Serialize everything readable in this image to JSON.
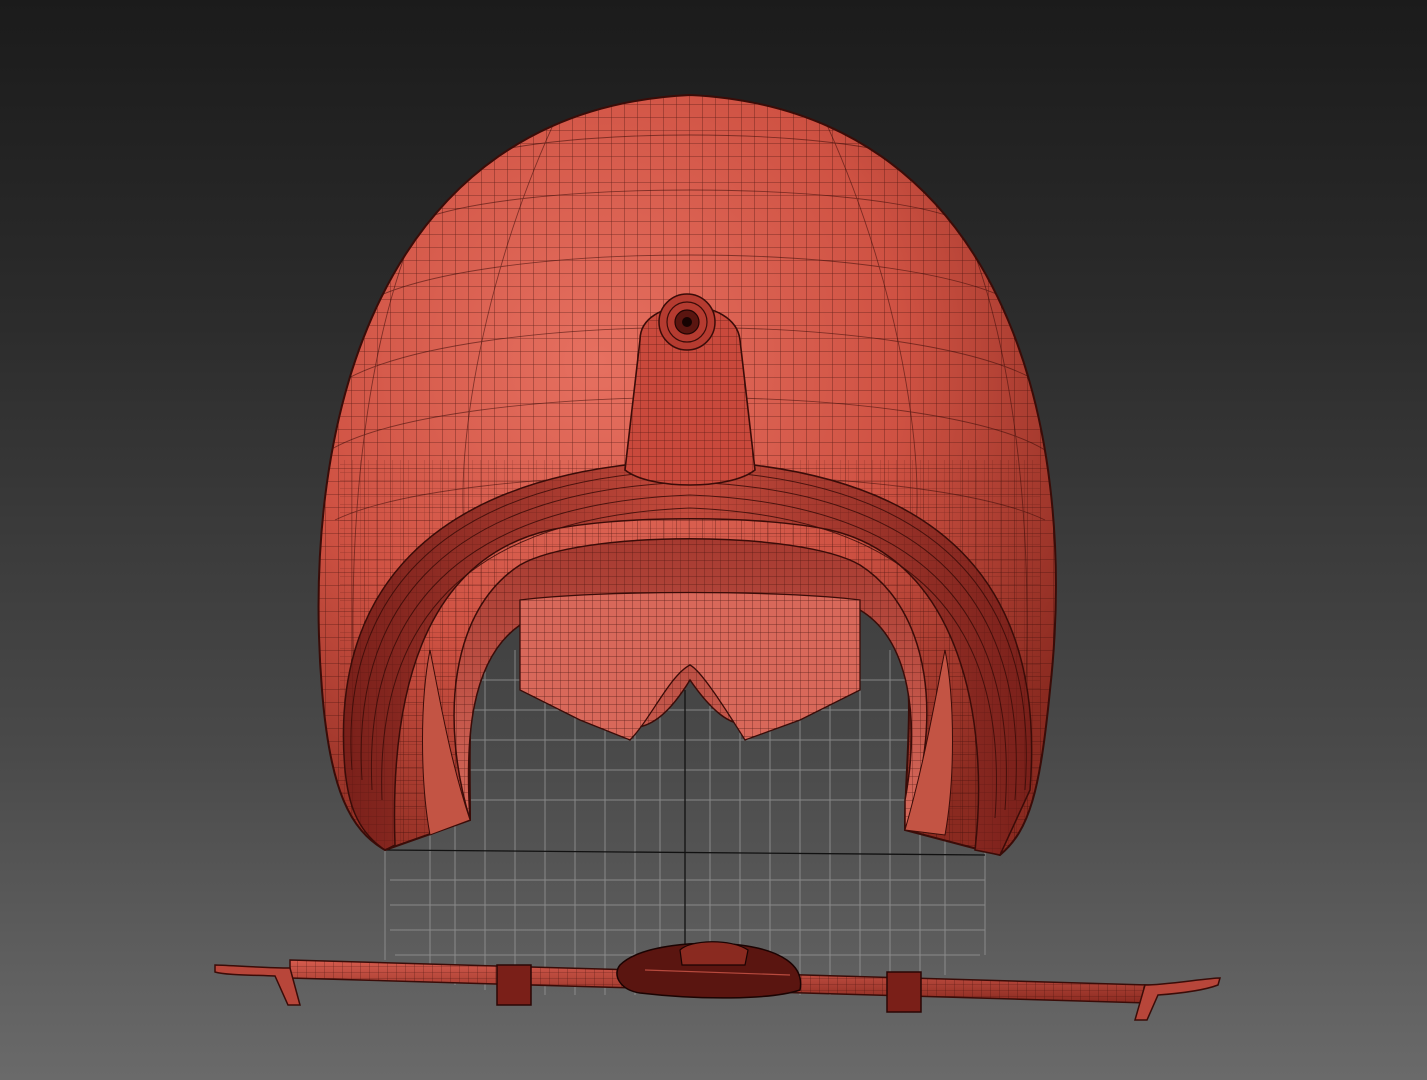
{
  "scene": {
    "subject": "helmet-wireframe-model",
    "colors": {
      "background_top": "#1b1b1b",
      "background_bottom": "#6a6a6a",
      "mesh_fill_light": "#e0685a",
      "mesh_fill_mid": "#c8493d",
      "mesh_fill_dark": "#7a1e18",
      "wire": "#3a0c08",
      "grid": "#9a9a9a",
      "axis": "#111111"
    }
  }
}
